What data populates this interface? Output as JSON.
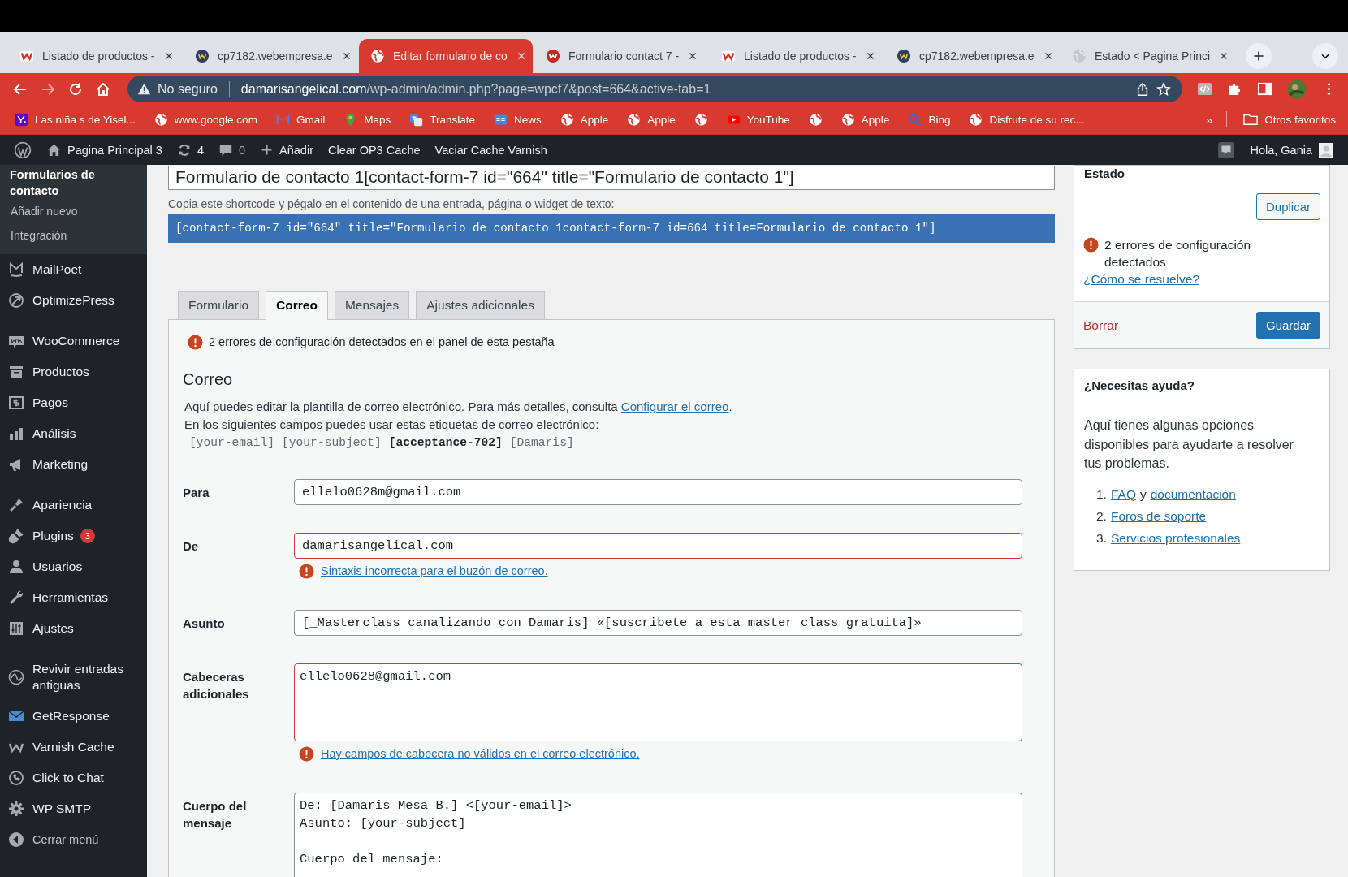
{
  "browser": {
    "tabs": [
      {
        "title": "Listado de productos -",
        "selected": false
      },
      {
        "title": "cp7182.webempresa.e",
        "selected": false
      },
      {
        "title": "Editar formulario de co",
        "selected": true
      },
      {
        "title": "Formulario contact 7 -",
        "selected": false
      },
      {
        "title": "Listado de productos -",
        "selected": false
      },
      {
        "title": "cp7182.webempresa.e",
        "selected": false
      },
      {
        "title": "Estado < Pagina Princi",
        "selected": false
      }
    ],
    "address": {
      "security": "No seguro",
      "domain": "damarisangelical.com",
      "path": "/wp-admin/admin.php?page=wpcf7&post=664&active-tab=1"
    },
    "bookmarks": [
      {
        "kind": "link",
        "label": "Las niña s de Yisel..."
      },
      {
        "kind": "link",
        "label": "www.google.com"
      },
      {
        "kind": "link",
        "label": "Gmail"
      },
      {
        "kind": "link",
        "label": "Maps"
      },
      {
        "kind": "link",
        "label": "Translate"
      },
      {
        "kind": "link",
        "label": "News"
      },
      {
        "kind": "link",
        "label": "Apple"
      },
      {
        "kind": "link",
        "label": "Apple"
      },
      {
        "kind": "icon"
      },
      {
        "kind": "link",
        "label": "YouTube"
      },
      {
        "kind": "icon"
      },
      {
        "kind": "link",
        "label": "Apple"
      },
      {
        "kind": "link",
        "label": "Bing"
      },
      {
        "kind": "link",
        "label": "Disfrute de su rec..."
      }
    ],
    "more_bookmarks": "»",
    "other_bookmarks": "Otros favoritos"
  },
  "admin_bar": {
    "site": "Pagina Principal 3",
    "updates": "4",
    "comments": "0",
    "new": "Añadir",
    "links": [
      "Clear OP3 Cache",
      "Vaciar Cache Varnish"
    ],
    "greeting": "Hola, Gania"
  },
  "sidebar": {
    "submenu": {
      "title": "Formularios de contacto",
      "items": [
        "Añadir nuevo",
        "Integración"
      ]
    },
    "groups": [
      [
        {
          "label": "MailPoet"
        },
        {
          "label": "OptimizePress"
        }
      ],
      [
        {
          "label": "WooCommerce"
        },
        {
          "label": "Productos"
        },
        {
          "label": "Pagos"
        },
        {
          "label": "Análisis"
        },
        {
          "label": "Marketing"
        }
      ],
      [
        {
          "label": "Apariencia"
        },
        {
          "label": "Plugins",
          "badge": "3"
        },
        {
          "label": "Usuarios"
        },
        {
          "label": "Herramientas"
        },
        {
          "label": "Ajustes"
        }
      ],
      [
        {
          "label": "Revivir entradas antiguas"
        },
        {
          "label": "GetResponse"
        },
        {
          "label": "Varnish Cache"
        },
        {
          "label": "Click to Chat"
        },
        {
          "label": "WP SMTP"
        }
      ]
    ],
    "collapse": "Cerrar menú"
  },
  "editor": {
    "title": "Formulario de contacto 1[contact-form-7 id=\"664\" title=\"Formulario de contacto 1\"]",
    "shortcode_hint": "Copia este shortcode y pégalo en el contenido de una entrada, página o widget de texto:",
    "shortcode": "[contact-form-7 id=\"664\" title=\"Formulario de contacto 1contact-form-7 id=664 title=Formulario de contacto 1\"]",
    "tabs": [
      {
        "label": "Formulario",
        "selected": false
      },
      {
        "label": "Correo",
        "selected": true
      },
      {
        "label": "Mensajes",
        "selected": false
      },
      {
        "label": "Ajustes adicionales",
        "selected": false
      }
    ],
    "panel_error": "2 errores de configuración detectados en el panel de esta pestaña",
    "heading": "Correo",
    "intro": "Aquí puedes editar la plantilla de correo electrónico. Para más detalles, consulta ",
    "intro_link": "Configurar el correo",
    "intro_end": ".",
    "tags_intro": "En los siguientes campos puedes usar estas etiquetas de correo electrónico:",
    "mail_tags": [
      {
        "tag": "[your-email]",
        "highlighted": false
      },
      {
        "tag": "[your-subject]",
        "highlighted": false
      },
      {
        "tag": "[acceptance-702]",
        "highlighted": true
      },
      {
        "tag": "[Damaris]",
        "highlighted": false
      }
    ],
    "fields": [
      {
        "kind": "input",
        "label": "Para",
        "value": "ellelo0628m@gmail.com",
        "invalid": false
      },
      {
        "kind": "input",
        "label": "De",
        "value": "damarisangelical.com",
        "invalid": true,
        "error": "Sintaxis incorrecta para el buzón de correo."
      },
      {
        "kind": "input",
        "label": "Asunto",
        "value": "[_Masterclass canalizando con Damaris] «[suscribete a esta master class gratuita]»",
        "invalid": false
      },
      {
        "kind": "textarea",
        "label": "Cabeceras adicionales",
        "value": "ellelo0628@gmail.com",
        "invalid": true,
        "error": "Hay campos de cabecera no válidos en el correo electrónico."
      },
      {
        "kind": "body",
        "label": "Cuerpo del mensaje",
        "value": "De: [Damaris Mesa B.] <[your-email]>\nAsunto: [your-subject]\n\nCuerpo del mensaje:",
        "invalid": false
      }
    ]
  },
  "status_box": {
    "heading": "Estado",
    "duplicate": "Duplicar",
    "error": "2 errores de configuración detectados",
    "help_link": "¿Cómo se resuelve?",
    "delete": "Borrar",
    "save": "Guardar"
  },
  "help_box": {
    "heading": "¿Necesitas ayuda?",
    "text": "Aquí tienes algunas opciones disponibles para ayudarte a resolver tus problemas.",
    "items": [
      {
        "number": "1.",
        "parts": [
          {
            "text": "FAQ",
            "link": true
          },
          {
            "text": "y",
            "link": false
          },
          {
            "text": "documentación",
            "link": true
          }
        ]
      },
      {
        "number": "2.",
        "parts": [
          {
            "text": "Foros de soporte",
            "link": true
          }
        ]
      },
      {
        "number": "3.",
        "parts": [
          {
            "text": "Servicios profesionales",
            "link": true
          }
        ]
      }
    ]
  }
}
